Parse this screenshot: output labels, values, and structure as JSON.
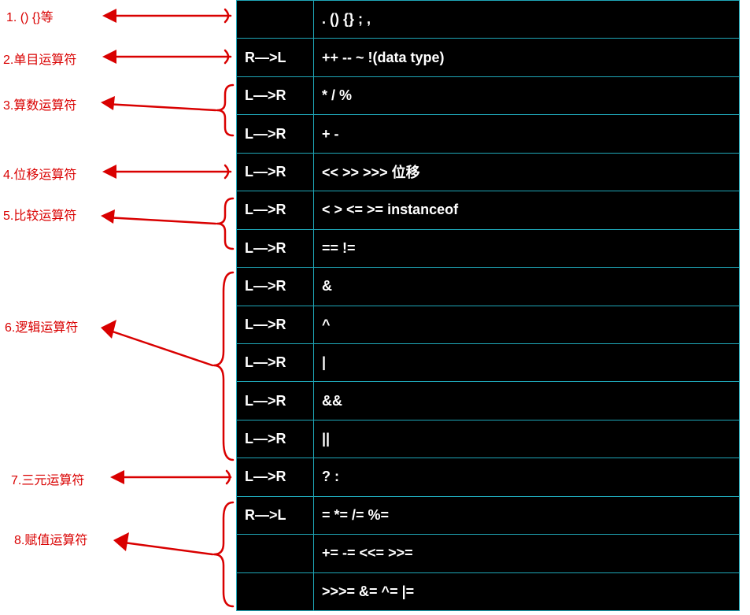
{
  "labels": {
    "l1": "1.  ()   {}等",
    "l2": "2.单目运算符",
    "l3": "3.算数运算符",
    "l4": "4.位移运算符",
    "l5": "5.比较运算符",
    "l6": "6.逻辑运算符",
    "l7": "7.三元运算符",
    "l8": "8.赋值运算符"
  },
  "rows": [
    {
      "assoc": "",
      "ops": ".      ()      {}    ;    ,"
    },
    {
      "assoc": "R—>L",
      "ops": "++    --    ~     !(data type)"
    },
    {
      "assoc": "L—>R",
      "ops": "*    /    %"
    },
    {
      "assoc": "L—>R",
      "ops": "+    -"
    },
    {
      "assoc": "L—>R",
      "ops": "<<    >>    >>>   位移"
    },
    {
      "assoc": "L—>R",
      "ops": "<    >    <=    >=     instanceof"
    },
    {
      "assoc": "L—>R",
      "ops": "==    !="
    },
    {
      "assoc": "L—>R",
      "ops": "&"
    },
    {
      "assoc": "L—>R",
      "ops": "^"
    },
    {
      "assoc": "L—>R",
      "ops": "|"
    },
    {
      "assoc": "L—>R",
      "ops": "&&"
    },
    {
      "assoc": "L—>R",
      "ops": "||"
    },
    {
      "assoc": "L—>R",
      "ops": "?    :"
    },
    {
      "assoc": "R—>L",
      "ops": "=    *=     /=    %="
    },
    {
      "assoc": "",
      "ops": "+=    -=    <<=    >>="
    },
    {
      "assoc": "",
      "ops": ">>>=    &=    ^=    |="
    }
  ]
}
